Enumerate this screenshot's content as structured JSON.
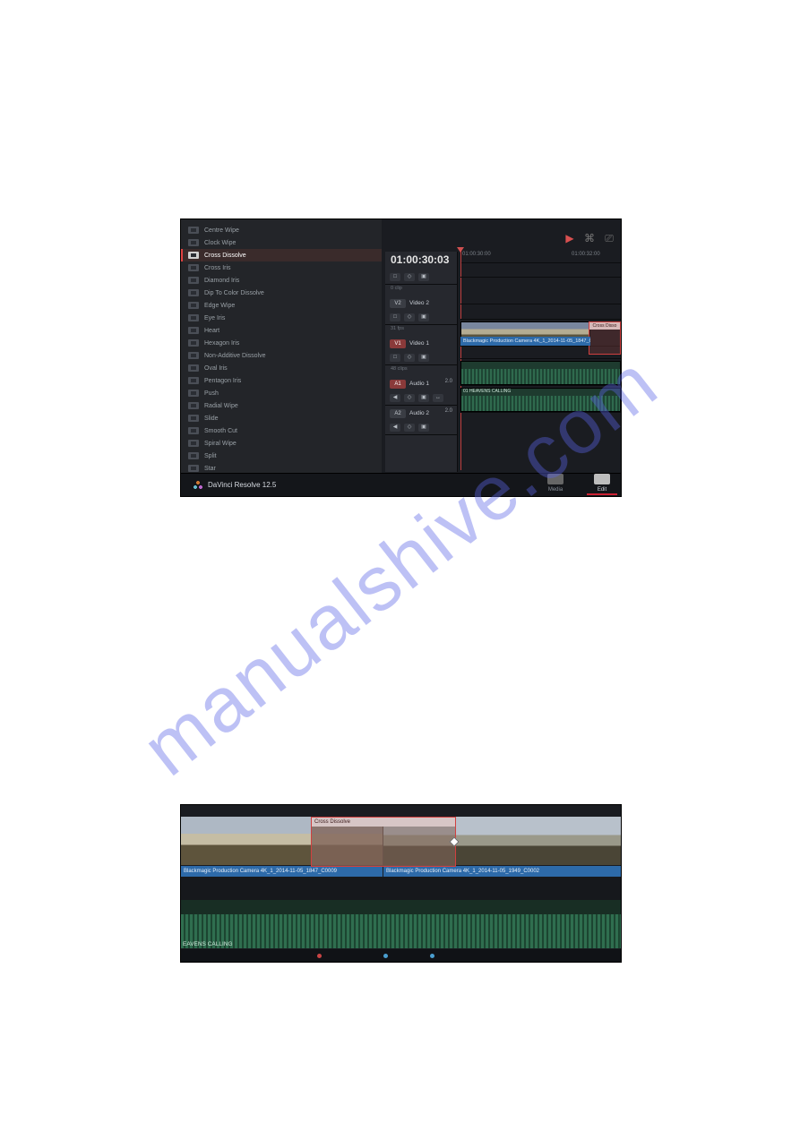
{
  "watermark": "manualshive.com",
  "transitions": [
    "Centre Wipe",
    "Clock Wipe",
    "Cross Dissolve",
    "Cross Iris",
    "Diamond Iris",
    "Dip To Color Dissolve",
    "Edge Wipe",
    "Eye Iris",
    "Heart",
    "Hexagon Iris",
    "Non-Additive Dissolve",
    "Oval Iris",
    "Pentagon Iris",
    "Push",
    "Radial Wipe",
    "Slide",
    "Smooth Cut",
    "Spiral Wipe",
    "Split",
    "Star"
  ],
  "transitions_selected_index": 2,
  "timecode": "01:00:30:03",
  "ruler_ticks": {
    "left": "01:00:30:00",
    "right": "01:00:32:00"
  },
  "tracks": {
    "v3": {
      "sub": "0 clip"
    },
    "v2": {
      "tag": "V2",
      "name": "Video 2",
      "btns": [
        "□",
        "◇",
        "▣"
      ]
    },
    "v2sub": {
      "sub": "31 fps"
    },
    "v1": {
      "tag": "V1",
      "name": "Video 1",
      "btns": [
        "□",
        "◇",
        "▣"
      ]
    },
    "v1sub": {
      "sub": "48 clips"
    },
    "a1": {
      "tag": "A1",
      "name": "Audio 1",
      "num": "2.0",
      "btns": [
        "◀",
        "◇",
        "▣",
        "↔"
      ]
    },
    "a2": {
      "tag": "A2",
      "name": "Audio 2",
      "num": "2.0",
      "btns": [
        "◀",
        "◇",
        "▣"
      ]
    }
  },
  "clip_v1_label": "Blackmagic Production Camera 4K_1_2014-11-05_1847_C0009",
  "clip_trans_label": "Cross Disso",
  "clip_a2_label": "01 HEAVENS CALLING",
  "footer": {
    "title": "DaVinci Resolve 12.5",
    "nav": [
      "Media",
      "Edit"
    ],
    "nav_selected": 1
  },
  "panel_b": {
    "clip_left_name": "Blackmagic Production Camera 4K_1_2014-11-05_1847_C0009",
    "clip_right_name": "Blackmagic Production Camera 4K_1_2014-11-05_1949_C0002",
    "trans_label": "Cross Dissolve",
    "audio_label": "EAVENS CALLING"
  }
}
